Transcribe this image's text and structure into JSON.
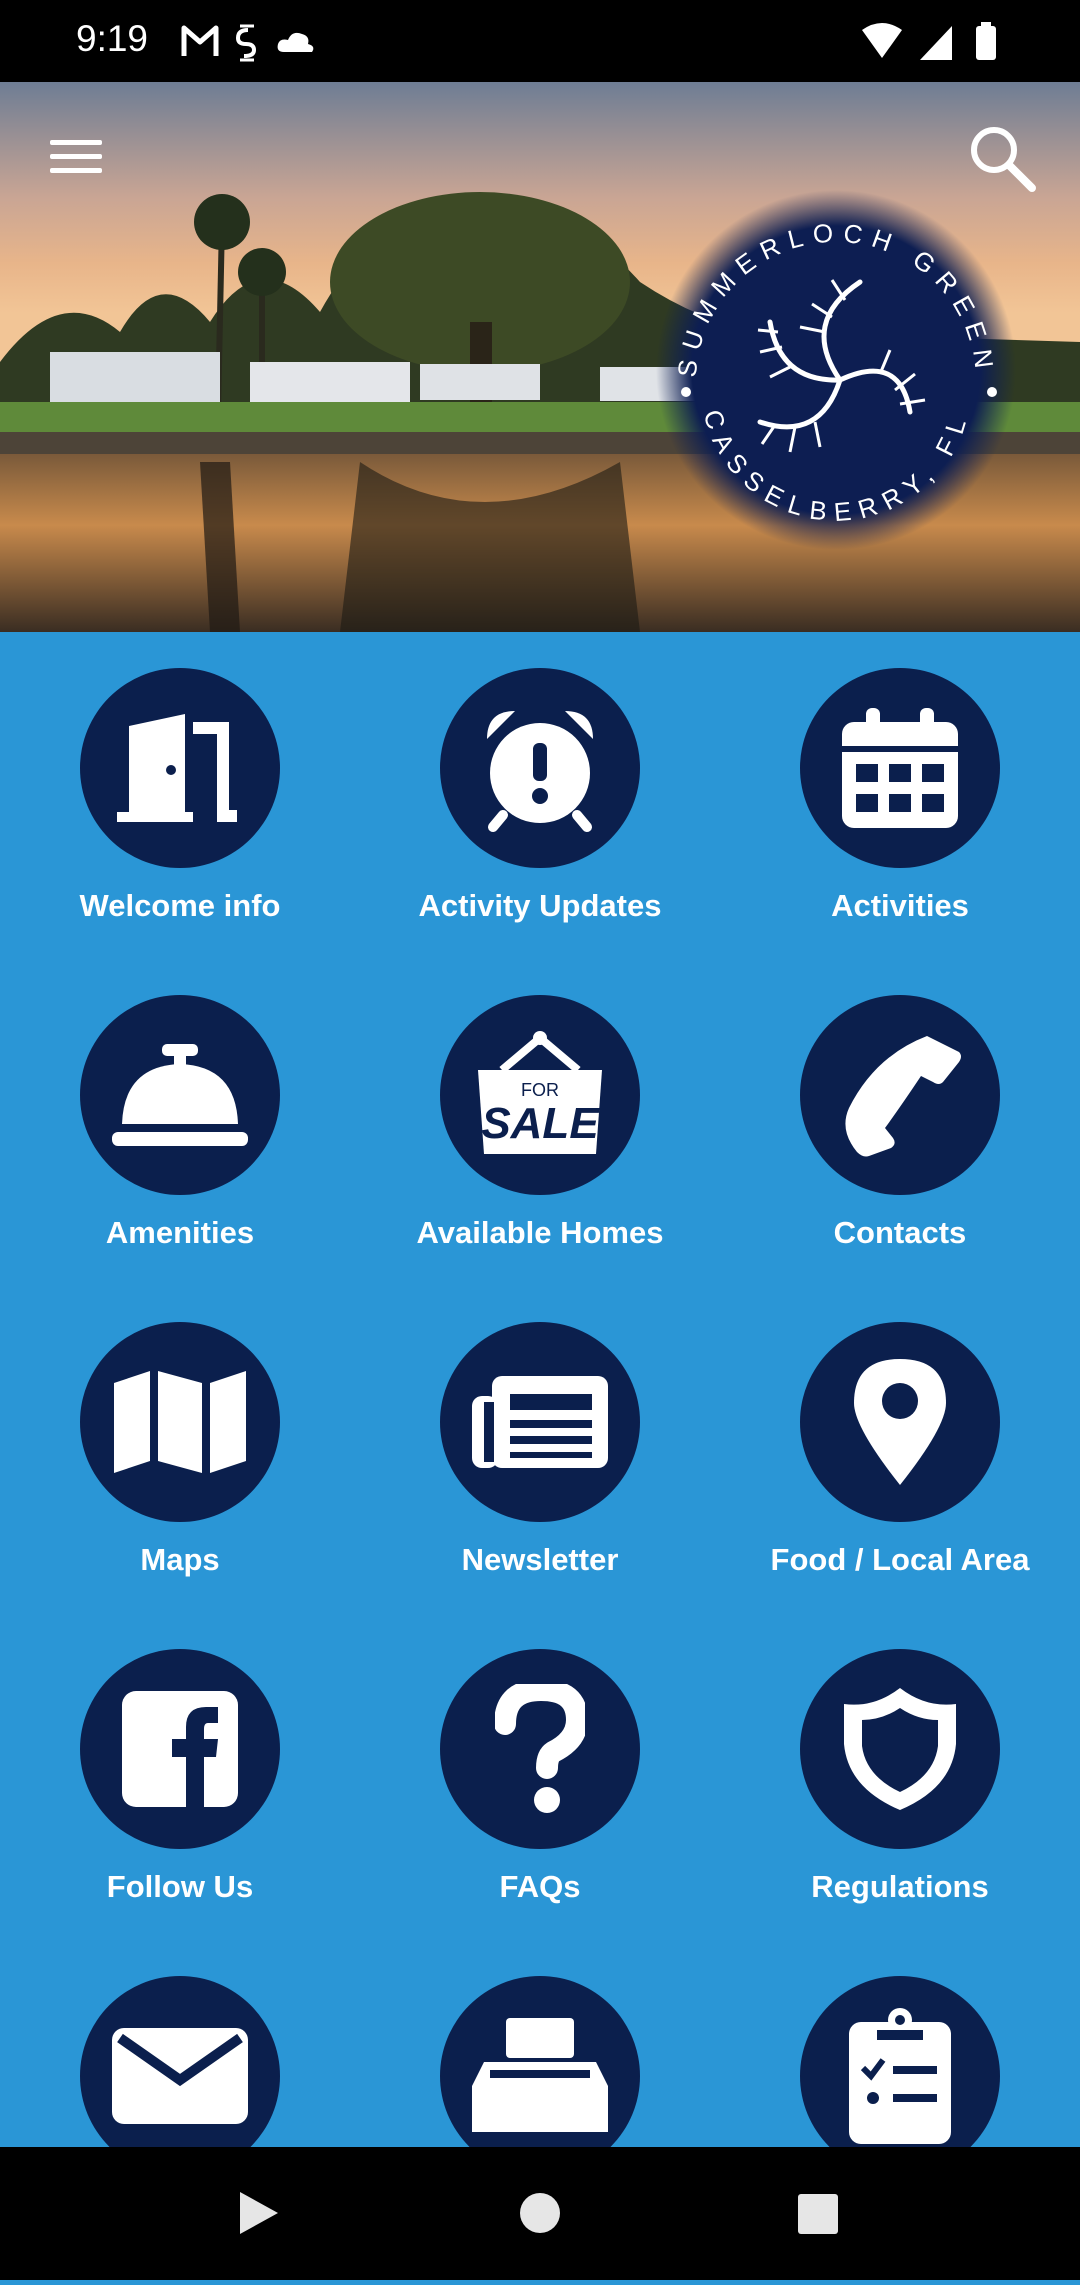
{
  "status_bar": {
    "time": "9:19",
    "left_icons": [
      "gmail-icon",
      "sync-icon",
      "cloud-icon"
    ],
    "right_icons": [
      "wifi-icon",
      "signal-icon",
      "battery-icon"
    ]
  },
  "header": {
    "logo_text_top": "SUMMERLOCH GREEN",
    "logo_text_bottom": "CASSELBERRY, FL"
  },
  "colors": {
    "background": "#2a96d6",
    "circle": "#0b1f4d",
    "label": "#ffffff"
  },
  "tiles": [
    {
      "label": "Welcome info",
      "icon": "door-icon"
    },
    {
      "label": "Activity Updates",
      "icon": "alarm-clock-icon"
    },
    {
      "label": "Activities",
      "icon": "calendar-icon"
    },
    {
      "label": "Amenities",
      "icon": "service-bell-icon"
    },
    {
      "label": "Available Homes",
      "icon": "for-sale-sign-icon",
      "sign_small": "FOR",
      "sign_big": "SALE"
    },
    {
      "label": "Contacts",
      "icon": "phone-icon"
    },
    {
      "label": "Maps",
      "icon": "map-icon"
    },
    {
      "label": "Newsletter",
      "icon": "newspaper-icon"
    },
    {
      "label": "Food / Local Area",
      "icon": "map-pin-icon"
    },
    {
      "label": "Follow Us",
      "icon": "facebook-icon"
    },
    {
      "label": "FAQs",
      "icon": "question-mark-icon"
    },
    {
      "label": "Regulations",
      "icon": "shield-icon"
    },
    {
      "label": "",
      "icon": "envelope-icon"
    },
    {
      "label": "",
      "icon": "fax-machine-icon"
    },
    {
      "label": "",
      "icon": "clipboard-checklist-icon"
    }
  ],
  "nav_bar": [
    "back-icon",
    "home-icon",
    "recents-icon"
  ]
}
